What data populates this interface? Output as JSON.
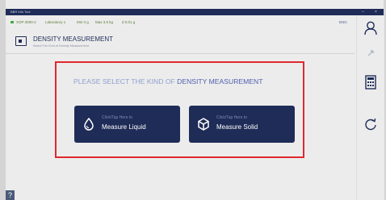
{
  "window": {
    "title": "BBR Info Tool",
    "controls": [
      "–",
      "×"
    ]
  },
  "statusbar": {
    "device": "XOP 3000-2",
    "location": "Laboratory 1",
    "min": "Min 0 g",
    "max": "Max 3.5 kg",
    "resolution": "d 0.01 g",
    "language": "ENG",
    "status_color": "#48a548"
  },
  "header": {
    "title": "DENSITY MEASUREMENT",
    "subtitle": "Select The Kind of Density Measurement"
  },
  "prompt": {
    "part1": "PLEASE SELECT THE KIND OF",
    "part2": "DENSITY MEASUREMENT"
  },
  "buttons": [
    {
      "hint": "Click/Tap Here to",
      "label": "Measure Liquid",
      "icon": "droplet-icon"
    },
    {
      "hint": "Click/Tap Here to",
      "label": "Measure Solid",
      "icon": "cube-icon"
    }
  ],
  "sidebar": {
    "icons": [
      "user-icon",
      "tools-icon",
      "calculator-icon",
      "refresh-icon"
    ]
  },
  "help": {
    "label": "?"
  },
  "colors": {
    "accent": "#1f2c57",
    "highlight": "#e0282e",
    "prompt_light": "#8f9fcf",
    "prompt_dark": "#4d5fb0"
  }
}
